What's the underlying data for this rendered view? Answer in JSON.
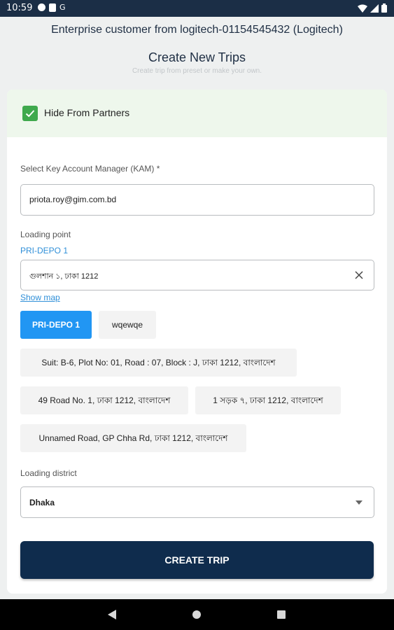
{
  "status_bar": {
    "time": "10:59",
    "icons": [
      "chat-icon",
      "sim-icon",
      "g-icon",
      "wifi-icon",
      "signal-icon",
      "battery-icon"
    ],
    "g_glyph": "G"
  },
  "header": {
    "title": "Enterprise customer from logitech-01154545432 (Logitech)",
    "page_title": "Create New Trips",
    "subtitle": "Create trip from preset or make your own."
  },
  "form": {
    "hide_from_partners": {
      "label": "Hide From Partners",
      "checked": true
    },
    "kam": {
      "label": "Select Key Account Manager (KAM) *",
      "value": "priota.roy@gim.com.bd"
    },
    "loading_point": {
      "label": "Loading point",
      "selected_name": "PRI-DEPO 1",
      "value": "গুলশান ১, ঢাকা 1212",
      "show_map": "Show map",
      "presets": [
        "PRI-DEPO 1",
        "wqewqe"
      ],
      "addresses": [
        "Suit: B-6, Plot No: 01, Road : 07, Block : J, ঢাকা 1212, বাংলাদেশ",
        "49 Road No. 1, ঢাকা 1212, বাংলাদেশ",
        "1 সড়ক ৭, ঢাকা 1212, বাংলাদেশ",
        "Unnamed Road, GP Chha Rd, ঢাকা 1212, বাংলাদেশ"
      ]
    },
    "loading_district": {
      "label": "Loading district",
      "value": "Dhaka"
    },
    "submit_label": "CREATE TRIP"
  },
  "colors": {
    "primary_dark": "#0f2c4d",
    "accent_blue": "#2196f3",
    "link_blue": "#2f8fd8",
    "check_green": "#3fa94d",
    "status_bar": "#1b2e46"
  }
}
